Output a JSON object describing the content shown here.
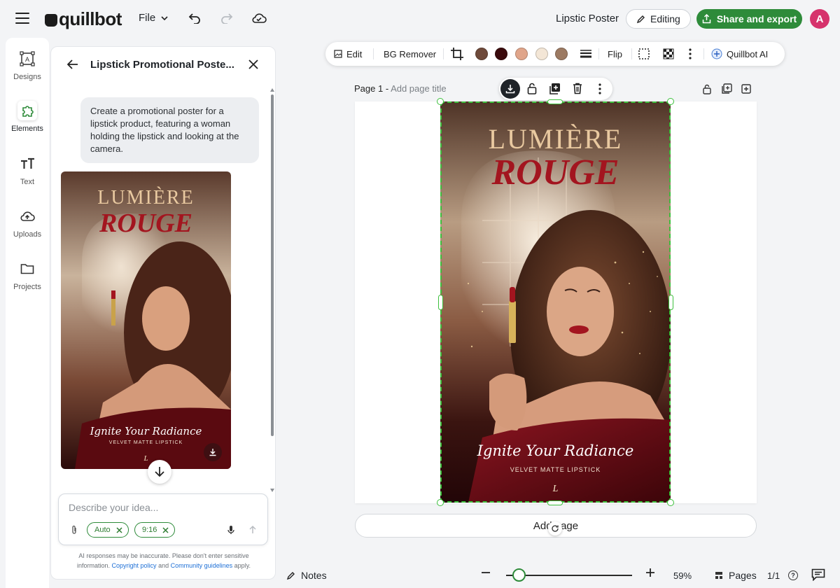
{
  "app": {
    "logo_text": "quillbot",
    "file_menu_label": "File",
    "doc_title": "Lipstic Poster",
    "editing_label": "Editing",
    "share_label": "Share and export",
    "avatar_initial": "A",
    "brand_color": "#2e8b3a"
  },
  "rail": {
    "items": [
      {
        "label": "Designs",
        "icon": "designs-icon"
      },
      {
        "label": "Elements",
        "icon": "elements-icon",
        "active": true
      },
      {
        "label": "Text",
        "icon": "text-icon"
      },
      {
        "label": "Uploads",
        "icon": "cloud-upload-icon"
      },
      {
        "label": "Projects",
        "icon": "folder-icon"
      }
    ]
  },
  "chat": {
    "title": "Lipstick Promotional Poste...",
    "user_message": "Create a promotional poster for a lipstick product, featuring a woman holding the lipstick and looking at the camera.",
    "prompt_placeholder": "Describe your idea...",
    "chips": [
      "Auto",
      "9:16"
    ],
    "disclaimer_text": "AI responses may be inaccurate. Please don't enter sensitive information.",
    "copyright_link": "Copyright policy",
    "and_text": "and",
    "guidelines_link": "Community guidelines",
    "apply_text": "apply."
  },
  "toolbar": {
    "edit_label": "Edit",
    "bg_remover_label": "BG Remover",
    "flip_label": "Flip",
    "ai_label": "Quillbot AI",
    "swatches": [
      "#6e4a3a",
      "#3a0a0c",
      "#e0a58a",
      "#f3e6d6",
      "#9c7a62"
    ]
  },
  "canvas": {
    "page_label": "Page 1 -",
    "page_title_placeholder": "Add page title",
    "add_page_label": "Add page"
  },
  "poster": {
    "title": "LUMIÈRE",
    "brand": "ROUGE",
    "tagline": "Ignite Your Radiance",
    "subtitle": "VELVET MATTE LIPSTICK",
    "monogram": "L"
  },
  "bottom": {
    "notes_label": "Notes",
    "zoom_value": "59%",
    "zoom_level": 0.1,
    "pages_label": "Pages",
    "page_count": "1/1"
  }
}
